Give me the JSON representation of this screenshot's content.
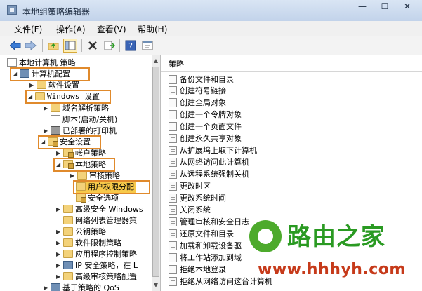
{
  "window": {
    "title": "本地组策略编辑器"
  },
  "menu": [
    "文件(F)",
    "操作(A)",
    "查看(V)",
    "帮助(H)"
  ],
  "tree": {
    "items": [
      {
        "label": "本地计算机 策略"
      },
      {
        "label": "计算机配置"
      },
      {
        "label": "软件设置"
      },
      {
        "label": "Windows 设置"
      },
      {
        "label": "域名解析策略"
      },
      {
        "label": "脚本(启动/关机)"
      },
      {
        "label": "已部署的打印机"
      },
      {
        "label": "安全设置"
      },
      {
        "label": "帐户策略"
      },
      {
        "label": "本地策略"
      },
      {
        "label": "审核策略"
      },
      {
        "label": "用户权限分配"
      },
      {
        "label": "安全选项"
      },
      {
        "label": "高级安全 Windows"
      },
      {
        "label": "网络列表管理器策"
      },
      {
        "label": "公钥策略"
      },
      {
        "label": "软件限制策略"
      },
      {
        "label": "应用程序控制策略"
      },
      {
        "label": "IP 安全策略，在 L"
      },
      {
        "label": "高级审核策略配置"
      },
      {
        "label": "基于策略的 QoS"
      }
    ]
  },
  "policy_list": {
    "header": "策略",
    "items": [
      "备份文件和目录",
      "创建符号链接",
      "创建全局对象",
      "创建一个令牌对象",
      "创建一个页面文件",
      "创建永久共享对象",
      "从扩展坞上取下计算机",
      "从网络访问此计算机",
      "从远程系统强制关机",
      "更改时区",
      "更改系统时间",
      "关闭系统",
      "管理审核和安全日志",
      "还原文件和目录",
      "加载和卸载设备驱",
      "将工作站添加到域",
      "拒绝本地登录",
      "拒绝从网络访问这台计算机"
    ]
  },
  "watermark": {
    "brand": "路由之家",
    "url": "www.hhhyh.com"
  },
  "colors": {
    "highlight_border": "#e08a2c",
    "highlight_fill": "#f7c94a"
  }
}
